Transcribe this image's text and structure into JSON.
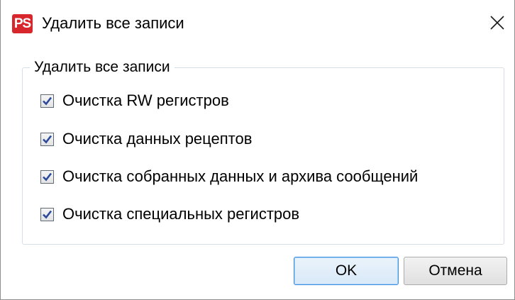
{
  "window": {
    "title": "Удалить все записи",
    "app_icon_text": "PS",
    "app_icon_color": "#d7262c",
    "close_icon": "close-icon"
  },
  "group": {
    "legend": "Удалить все записи"
  },
  "options": [
    {
      "label": "Очистка RW регистров",
      "checked": true
    },
    {
      "label": "Очистка данных рецептов",
      "checked": true
    },
    {
      "label": "Очистка собранных данных и архива сообщений",
      "checked": true
    },
    {
      "label": "Очистка специальных регистров",
      "checked": true
    }
  ],
  "buttons": {
    "ok_label": "OK",
    "cancel_label": "Отмена"
  },
  "colors": {
    "checkmark": "#2b4a9c",
    "default_button_border": "#3d8ee0"
  }
}
